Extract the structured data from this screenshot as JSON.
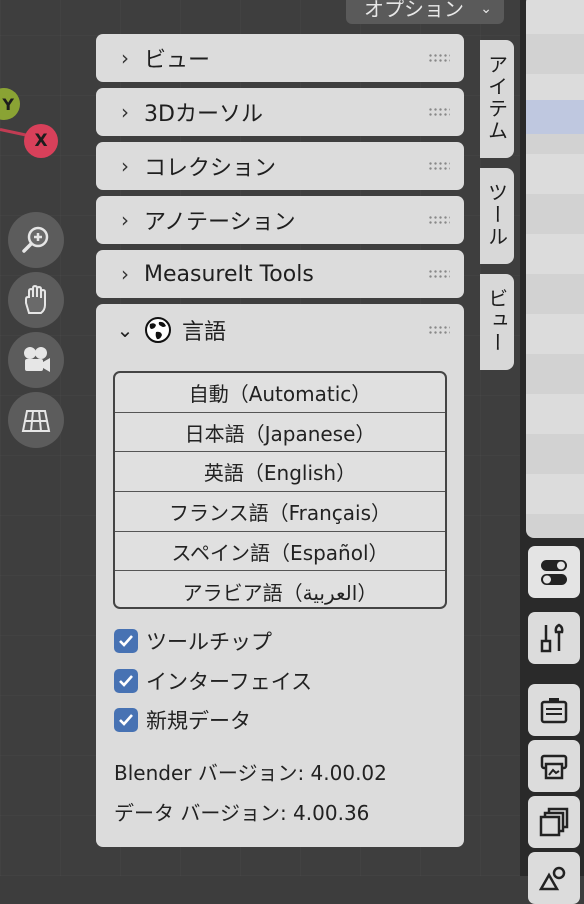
{
  "header": {
    "options_label": "オプション"
  },
  "axes": {
    "y": "Y",
    "x": "X"
  },
  "panels": [
    {
      "label": "ビュー"
    },
    {
      "label": "3Dカーソル"
    },
    {
      "label": "コレクション"
    },
    {
      "label": "アノテーション"
    },
    {
      "label": "MeasureIt Tools"
    }
  ],
  "language_panel": {
    "title": "言語",
    "languages": [
      "自動（Automatic）",
      "日本語（Japanese）",
      "英語（English）",
      "フランス語（Français）",
      "スペイン語（Español）",
      "アラビア語（العربية）"
    ],
    "checkboxes": [
      {
        "label": "ツールチップ",
        "checked": true
      },
      {
        "label": "インターフェイス",
        "checked": true
      },
      {
        "label": "新規データ",
        "checked": true
      }
    ],
    "blender_version": "Blender バージョン: 4.00.02",
    "data_version": "データ バージョン: 4.00.36"
  },
  "side_tabs": [
    "アイテム",
    "ツール",
    "ビュー"
  ],
  "colors": {
    "accent": "#4772b3",
    "x_axis": "#d8405a",
    "y_axis": "#8aa334"
  }
}
